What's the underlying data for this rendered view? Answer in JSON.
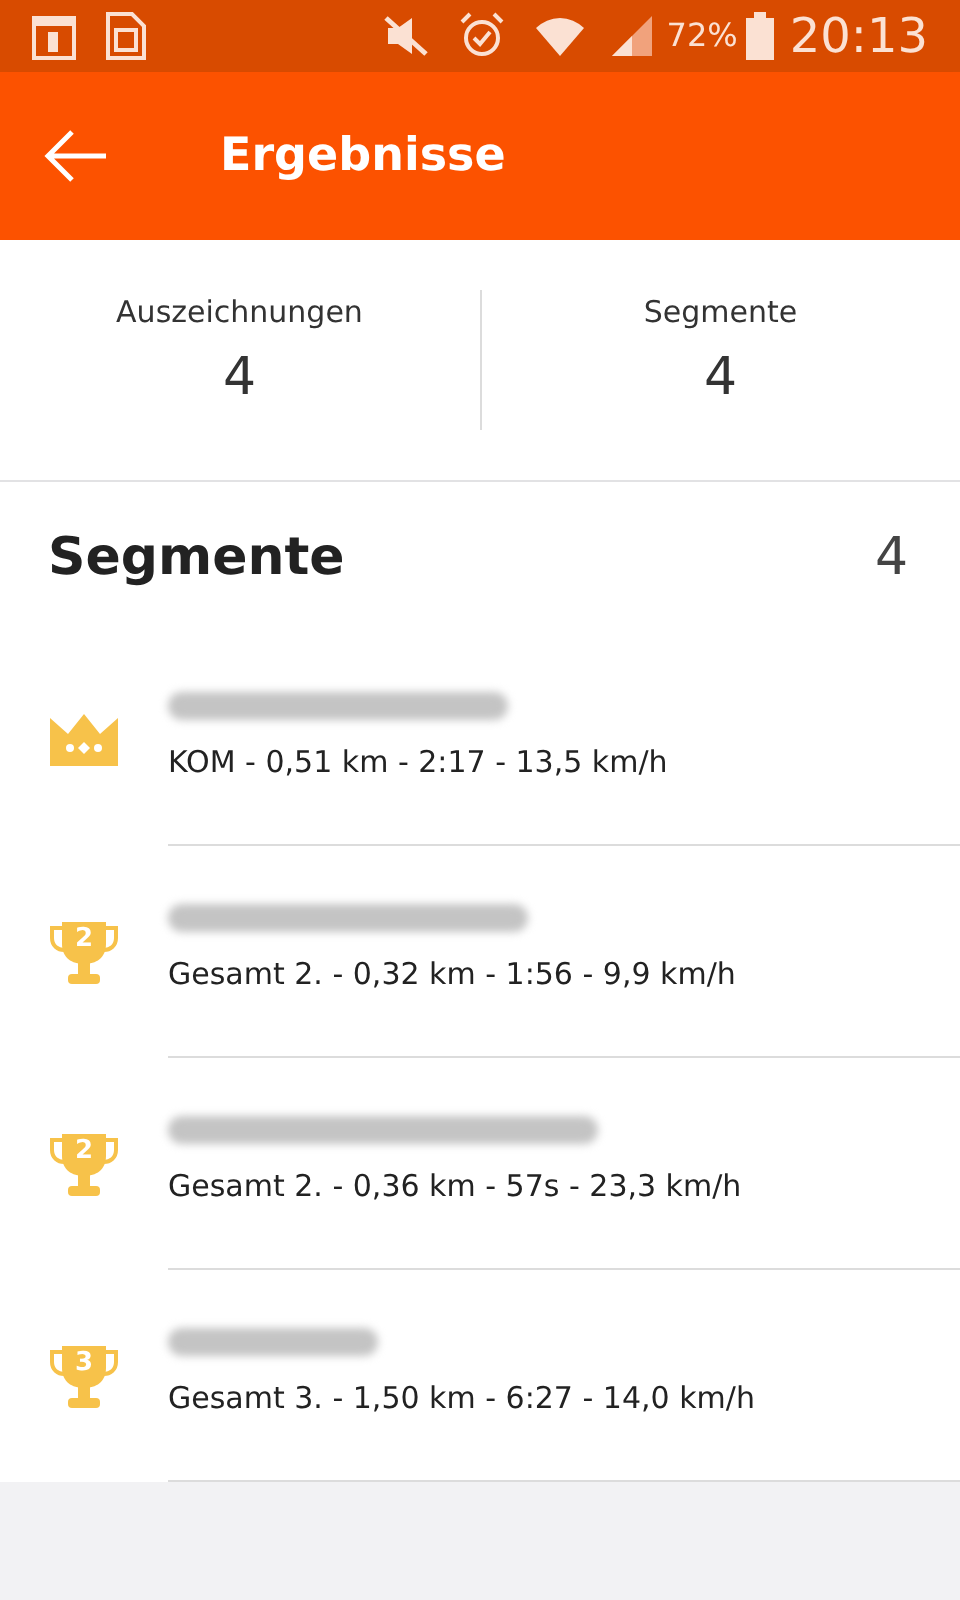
{
  "status_bar": {
    "battery": "72%",
    "time": "20:13"
  },
  "app_bar": {
    "title": "Ergebnisse"
  },
  "summary": [
    {
      "label": "Auszeichnungen",
      "value": "4"
    },
    {
      "label": "Segmente",
      "value": "4"
    }
  ],
  "segments": {
    "title": "Segmente",
    "count": "4",
    "items": [
      {
        "kind": "crown",
        "detail": "KOM - 0,51 km - 2:17 - 13,5 km/h"
      },
      {
        "kind": "trophy",
        "rank": "2",
        "detail": "Gesamt 2. - 0,32 km - 1:56 - 9,9 km/h"
      },
      {
        "kind": "trophy",
        "rank": "2",
        "detail": "Gesamt 2. - 0,36 km - 57s - 23,3 km/h"
      },
      {
        "kind": "trophy",
        "rank": "3",
        "detail": "Gesamt 3. - 1,50 km - 6:27 - 14,0 km/h"
      }
    ]
  }
}
